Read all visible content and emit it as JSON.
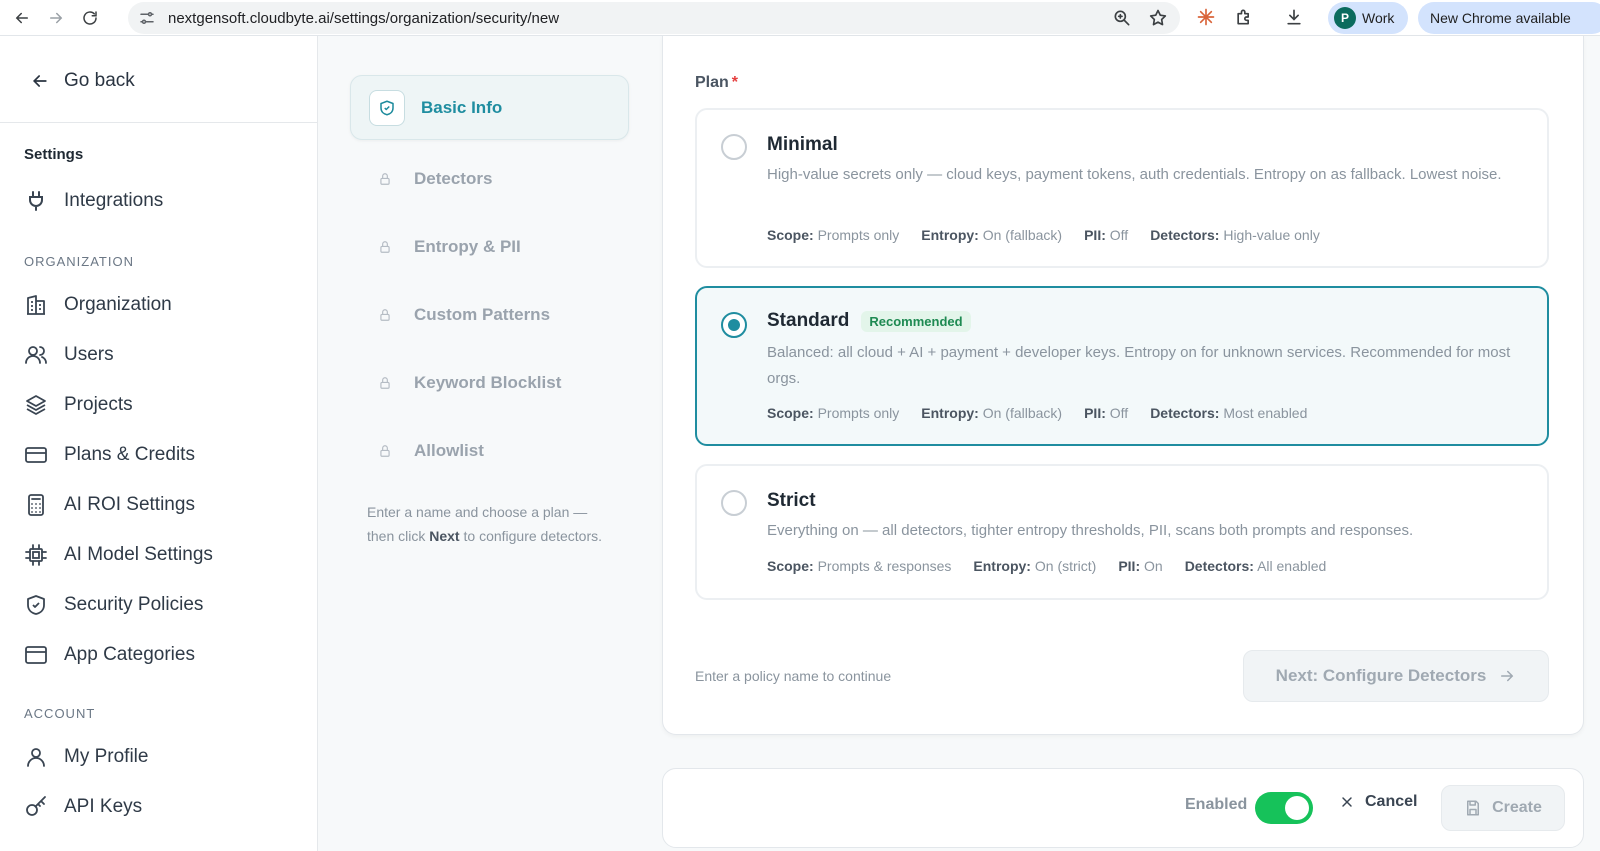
{
  "browser": {
    "url": "nextgensoft.cloudbyte.ai/settings/organization/security/new",
    "profile_initial": "P",
    "profile_name": "Work",
    "update_label": "New Chrome available"
  },
  "sidebar": {
    "go_back": "Go back",
    "settings_heading": "Settings",
    "top_items": [
      {
        "label": "Integrations",
        "icon": "plug-icon"
      }
    ],
    "organization_heading": "ORGANIZATION",
    "organization_items": [
      {
        "label": "Organization",
        "icon": "building-icon"
      },
      {
        "label": "Users",
        "icon": "users-icon"
      },
      {
        "label": "Projects",
        "icon": "layers-icon"
      },
      {
        "label": "Plans & Credits",
        "icon": "credit-card-icon"
      },
      {
        "label": "AI ROI Settings",
        "icon": "calculator-icon"
      },
      {
        "label": "AI Model Settings",
        "icon": "cpu-icon"
      },
      {
        "label": "Security Policies",
        "icon": "shield-check-icon"
      },
      {
        "label": "App Categories",
        "icon": "app-window-icon"
      }
    ],
    "account_heading": "ACCOUNT",
    "account_items": [
      {
        "label": "My Profile",
        "icon": "user-icon"
      },
      {
        "label": "API Keys",
        "icon": "key-icon"
      }
    ]
  },
  "steps": {
    "active": "Basic Info",
    "locked": [
      "Detectors",
      "Entropy & PII",
      "Custom Patterns",
      "Keyword Blocklist",
      "Allowlist"
    ],
    "hint_before": "Enter a name and choose a plan — then click ",
    "hint_bold": "Next",
    "hint_after": " to configure detectors."
  },
  "plan": {
    "label": "Plan",
    "required_mark": "*",
    "options": [
      {
        "title": "Minimal",
        "badge": "",
        "selected": false,
        "description": "High-value secrets only — cloud keys, payment tokens, auth credentials. Entropy on as fallback. Lowest noise.",
        "scope": "Prompts only",
        "entropy": "On (fallback)",
        "pii": "Off",
        "detectors": "High-value only"
      },
      {
        "title": "Standard",
        "badge": "Recommended",
        "selected": true,
        "description": "Balanced: all cloud + AI + payment + developer keys. Entropy on for unknown services. Recommended for most orgs.",
        "scope": "Prompts only",
        "entropy": "On (fallback)",
        "pii": "Off",
        "detectors": "Most enabled"
      },
      {
        "title": "Strict",
        "badge": "",
        "selected": false,
        "description": "Everything on — all detectors, tighter entropy thresholds, PII, scans both prompts and responses.",
        "scope": "Prompts & responses",
        "entropy": "On (strict)",
        "pii": "On",
        "detectors": "All enabled"
      }
    ],
    "meta_labels": {
      "scope": "Scope:",
      "entropy": "Entropy:",
      "pii": "PII:",
      "detectors": "Detectors:"
    }
  },
  "footer": {
    "continue_hint": "Enter a policy name to continue",
    "next_label": "Next: Configure Detectors",
    "enabled_label": "Enabled",
    "enabled": true,
    "cancel_label": "Cancel",
    "create_label": "Create"
  },
  "colors": {
    "accent": "#1f8da0",
    "toggle_on": "#16c25a",
    "badge_green": "#1e8a52"
  }
}
